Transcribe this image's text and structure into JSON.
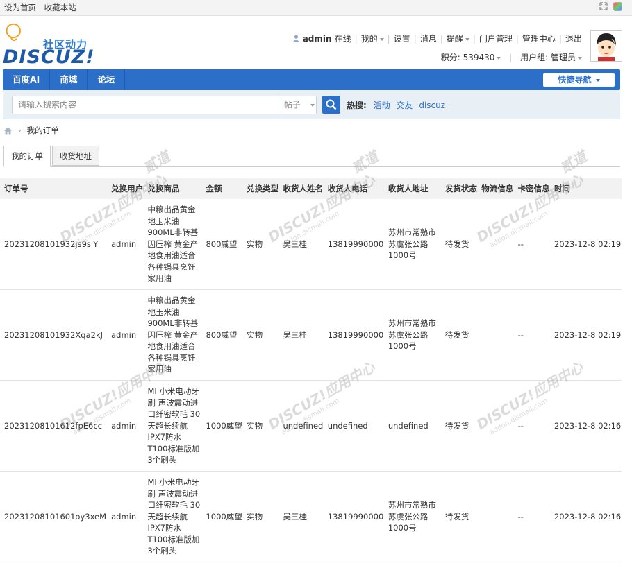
{
  "topbar": {
    "set_home": "设为首页",
    "bookmark": "收藏本站"
  },
  "logo": {
    "slogan": "社区动力",
    "word": "DISCUZ!"
  },
  "userbar": {
    "username": "admin",
    "status": "在线",
    "links": [
      "我的",
      "设置",
      "消息",
      "提醒",
      "门户管理",
      "管理中心",
      "退出"
    ],
    "points": "积分: 539430",
    "group": "用户组: 管理员"
  },
  "nav": {
    "items": [
      "百度AI",
      "商城",
      "论坛"
    ],
    "quick_nav": "快捷导航"
  },
  "search": {
    "placeholder": "请输入搜索内容",
    "type": "帖子",
    "hot_label": "热搜:",
    "keywords": [
      "活动",
      "交友",
      "discuz"
    ]
  },
  "breadcrumb": {
    "current": "我的订单"
  },
  "tabs": [
    "我的订单",
    "收货地址"
  ],
  "table": {
    "headers": [
      "订单号",
      "兑换用户",
      "兑换商品",
      "金额",
      "兑换类型",
      "收货人姓名",
      "收货人电话",
      "收货人地址",
      "发货状态",
      "物流信息",
      "卡密信息",
      "时间"
    ],
    "rows": [
      {
        "order": "20231208101932js9slY",
        "user": "admin",
        "product": "中粮出品黄金地玉米油900ML非转基因压榨 黄金产地食用油适合各种锅具烹饪家用油",
        "amount": "800威望",
        "type": "实物",
        "name": "吴三桂",
        "phone": "13819990000",
        "address": "苏州市常熟市苏虞张公路1000号",
        "ship": "待发货",
        "logistics": "",
        "card": "--",
        "time": "2023-12-8 02:19"
      },
      {
        "order": "20231208101932Xqa2kJ",
        "user": "admin",
        "product": "中粮出品黄金地玉米油900ML非转基因压榨 黄金产地食用油适合各种锅具烹饪家用油",
        "amount": "800威望",
        "type": "实物",
        "name": "吴三桂",
        "phone": "13819990000",
        "address": "苏州市常熟市苏虞张公路1000号",
        "ship": "待发货",
        "logistics": "",
        "card": "--",
        "time": "2023-12-8 02:19"
      },
      {
        "order": "20231208101612fpE6cc",
        "user": "admin",
        "product": "MI 小米电动牙刷 声波震动进口纤密软毛 30天超长续航 IPX7防水 T100标准版加3个刷头",
        "amount": "1000威望",
        "type": "实物",
        "name": "undefined",
        "phone": "undefined",
        "address": "undefined",
        "ship": "待发货",
        "logistics": "",
        "card": "--",
        "time": "2023-12-8 02:16"
      },
      {
        "order": "20231208101601oy3xeM",
        "user": "admin",
        "product": "MI 小米电动牙刷 声波震动进口纤密软毛 30天超长续航 IPX7防水 T100标准版加3个刷头",
        "amount": "1000威望",
        "type": "实物",
        "name": "吴三桂",
        "phone": "13819990000",
        "address": "苏州市常熟市苏虞张公路1000号",
        "ship": "待发货",
        "logistics": "",
        "card": "--",
        "time": "2023-12-8 02:16"
      }
    ]
  },
  "watermark": {
    "brand": "DISCUZ!应用中心",
    "domain": "addon.dismall.com",
    "mark": "贰道"
  }
}
